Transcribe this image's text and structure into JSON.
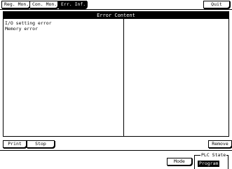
{
  "tabs": [
    {
      "label": "Reg. Mon.",
      "active": false
    },
    {
      "label": "Con. Mon.",
      "active": false
    },
    {
      "label": "Err. Inf.",
      "active": true
    }
  ],
  "quit_label": "Quit",
  "panel": {
    "title": "Error Content",
    "errors": [
      "I/O setting error",
      "Memory error"
    ]
  },
  "buttons": {
    "print": "Print",
    "stop": "Stop",
    "remove": "Remove",
    "mode": "Mode"
  },
  "plc_state": {
    "label": "PLC State",
    "value": "Program"
  }
}
